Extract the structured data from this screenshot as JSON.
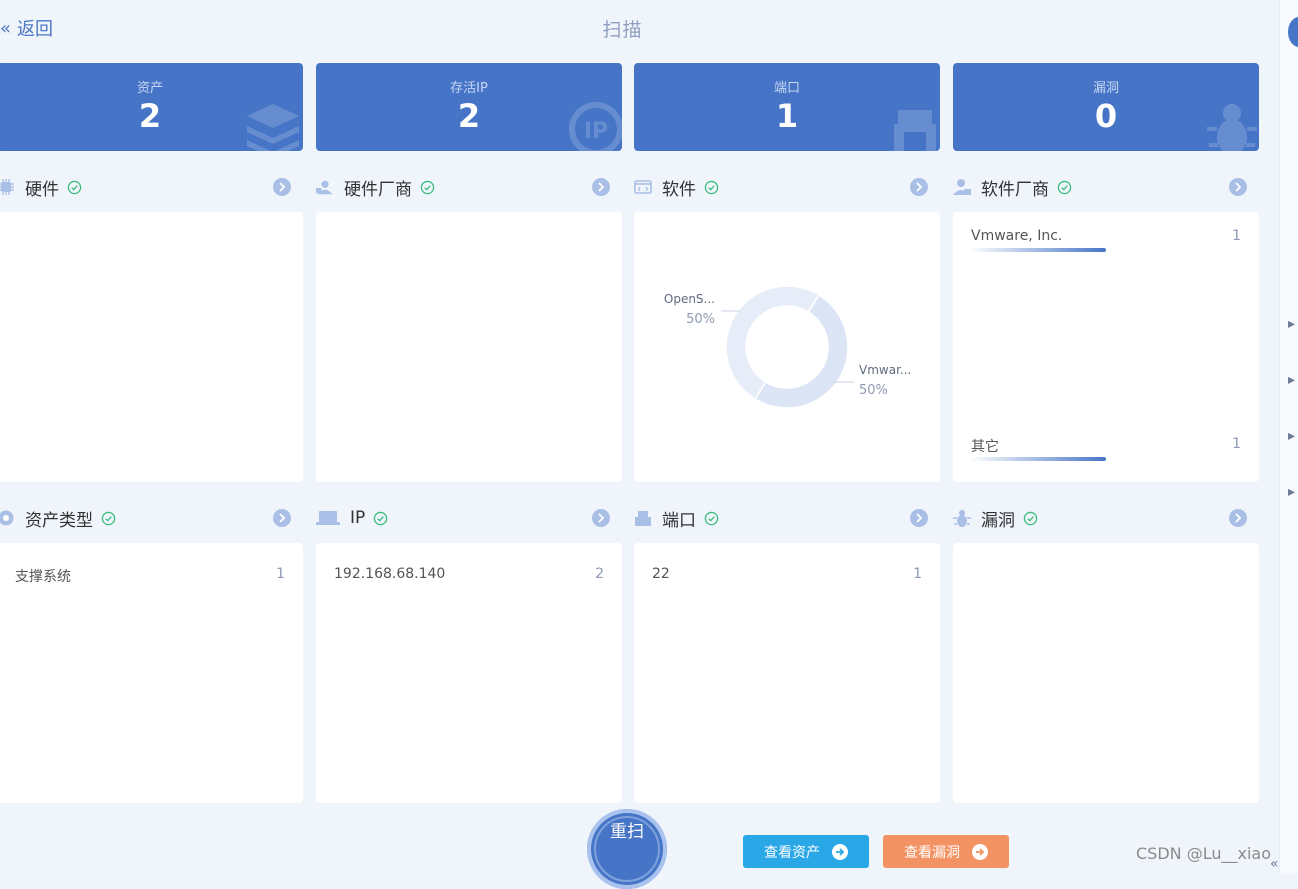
{
  "header": {
    "back_label": "返回",
    "title": "扫描"
  },
  "stats": [
    {
      "label": "资产",
      "value": "2",
      "icon": "stack-icon"
    },
    {
      "label": "存活IP",
      "value": "2",
      "icon": "ip-icon"
    },
    {
      "label": "端口",
      "value": "1",
      "icon": "port-icon"
    },
    {
      "label": "漏洞",
      "value": "0",
      "icon": "bug-icon"
    }
  ],
  "panels": {
    "hardware": {
      "title": "硬件"
    },
    "hardware_vendor": {
      "title": "硬件厂商"
    },
    "software": {
      "title": "软件",
      "chart_data": {
        "type": "pie",
        "donut": true,
        "categories": [
          "OpenS...",
          "Vmwar..."
        ],
        "values": [
          50,
          50
        ],
        "labels": [
          "50%",
          "50%"
        ],
        "colors": [
          "#dbe5f5",
          "#e6edf8"
        ]
      }
    },
    "software_vendor": {
      "title": "软件厂商",
      "items": [
        {
          "name": "Vmware, Inc.",
          "count": "1"
        },
        {
          "name": "其它",
          "count": "1"
        }
      ]
    },
    "asset_type": {
      "title": "资产类型",
      "items": [
        {
          "name": "支撑系统",
          "count": "1"
        }
      ]
    },
    "ip": {
      "title": "IP",
      "items": [
        {
          "name": "192.168.68.140",
          "count": "2"
        }
      ]
    },
    "port": {
      "title": "端口",
      "items": [
        {
          "name": "22",
          "count": "1"
        }
      ]
    },
    "vuln": {
      "title": "漏洞"
    }
  },
  "actions": {
    "rescan_label": "重扫",
    "view_assets_label": "查看资产",
    "view_vulns_label": "查看漏洞",
    "view_assets_color": "#2aa7e6",
    "view_vulns_color": "#f39262"
  },
  "watermark": "CSDN @Lu__xiao",
  "right_strip_glyphs": [
    "‹",
    "‹"
  ]
}
